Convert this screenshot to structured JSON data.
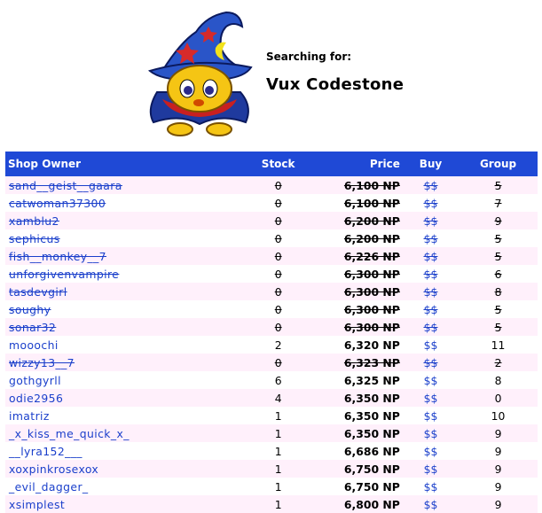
{
  "search": {
    "label": "Searching for:",
    "item": "Vux Codestone"
  },
  "colors": {
    "header_bg": "#1f49d6",
    "row_tint": "#fff0fb",
    "link": "#1a3fcb"
  },
  "table": {
    "headers": {
      "owner": "Shop Owner",
      "stock": "Stock",
      "price": "Price",
      "buy": "Buy",
      "group": "Group"
    },
    "rows": [
      {
        "owner": "sand__geist__gaara",
        "stock": "0",
        "price": "6,100 NP",
        "buy": "$$",
        "group": "5",
        "sold_out": true
      },
      {
        "owner": "catwoman37300",
        "stock": "0",
        "price": "6,100 NP",
        "buy": "$$",
        "group": "7",
        "sold_out": true
      },
      {
        "owner": "xamblu2",
        "stock": "0",
        "price": "6,200 NP",
        "buy": "$$",
        "group": "9",
        "sold_out": true
      },
      {
        "owner": "sephicus",
        "stock": "0",
        "price": "6,200 NP",
        "buy": "$$",
        "group": "5",
        "sold_out": true
      },
      {
        "owner": "fish__monkey__7",
        "stock": "0",
        "price": "6,226 NP",
        "buy": "$$",
        "group": "5",
        "sold_out": true
      },
      {
        "owner": "unforgivenvampire",
        "stock": "0",
        "price": "6,300 NP",
        "buy": "$$",
        "group": "6",
        "sold_out": true
      },
      {
        "owner": "tasdevgirl",
        "stock": "0",
        "price": "6,300 NP",
        "buy": "$$",
        "group": "8",
        "sold_out": true
      },
      {
        "owner": "soughy",
        "stock": "0",
        "price": "6,300 NP",
        "buy": "$$",
        "group": "5",
        "sold_out": true
      },
      {
        "owner": "sonar32",
        "stock": "0",
        "price": "6,300 NP",
        "buy": "$$",
        "group": "5",
        "sold_out": true
      },
      {
        "owner": "mooochi",
        "stock": "2",
        "price": "6,320 NP",
        "buy": "$$",
        "group": "11",
        "sold_out": false
      },
      {
        "owner": "wizzy13__7",
        "stock": "0",
        "price": "6,323 NP",
        "buy": "$$",
        "group": "2",
        "sold_out": true
      },
      {
        "owner": "gothgyrll",
        "stock": "6",
        "price": "6,325 NP",
        "buy": "$$",
        "group": "8",
        "sold_out": false
      },
      {
        "owner": "odie2956",
        "stock": "4",
        "price": "6,350 NP",
        "buy": "$$",
        "group": "0",
        "sold_out": false
      },
      {
        "owner": "imatriz",
        "stock": "1",
        "price": "6,350 NP",
        "buy": "$$",
        "group": "10",
        "sold_out": false
      },
      {
        "owner": "_x_kiss_me_quick_x_",
        "stock": "1",
        "price": "6,350 NP",
        "buy": "$$",
        "group": "9",
        "sold_out": false
      },
      {
        "owner": "__lyra152___",
        "stock": "1",
        "price": "6,686 NP",
        "buy": "$$",
        "group": "9",
        "sold_out": false
      },
      {
        "owner": "xoxpinkrosexox",
        "stock": "1",
        "price": "6,750 NP",
        "buy": "$$",
        "group": "9",
        "sold_out": false
      },
      {
        "owner": "_evil_dagger_",
        "stock": "1",
        "price": "6,750 NP",
        "buy": "$$",
        "group": "9",
        "sold_out": false
      },
      {
        "owner": "xsimplest",
        "stock": "1",
        "price": "6,800 NP",
        "buy": "$$",
        "group": "9",
        "sold_out": false
      }
    ]
  }
}
